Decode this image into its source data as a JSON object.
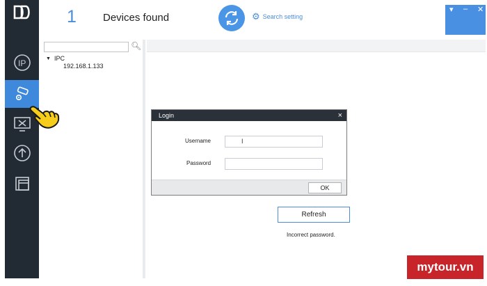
{
  "header": {
    "device_count": "1",
    "devices_found_label": "Devices found",
    "search_setting_label": "Search setting"
  },
  "window_controls": [
    "▾",
    "–",
    "✕"
  ],
  "sidebar": {
    "items": [
      {
        "icon": "ip-icon",
        "active": false
      },
      {
        "icon": "device-config-icon",
        "active": true
      },
      {
        "icon": "tools-icon",
        "active": false
      },
      {
        "icon": "upgrade-icon",
        "active": false
      },
      {
        "icon": "windows-icon",
        "active": false
      }
    ]
  },
  "tree": {
    "search_placeholder": "",
    "root_label": "IPC",
    "children": [
      "192.168.1.133"
    ]
  },
  "login_dialog": {
    "title": "Login",
    "close_glyph": "×",
    "username_label": "Username",
    "password_label": "Password",
    "username_value": "",
    "password_value": "",
    "ok_label": "OK"
  },
  "main": {
    "refresh_label": "Refresh",
    "status_text": "Incorrect password."
  },
  "watermark": "mytour.vn",
  "colors": {
    "sidebar": "#222a33",
    "accent": "#4a90e2",
    "active": "#3f89dc",
    "watermark": "#c8252a"
  }
}
